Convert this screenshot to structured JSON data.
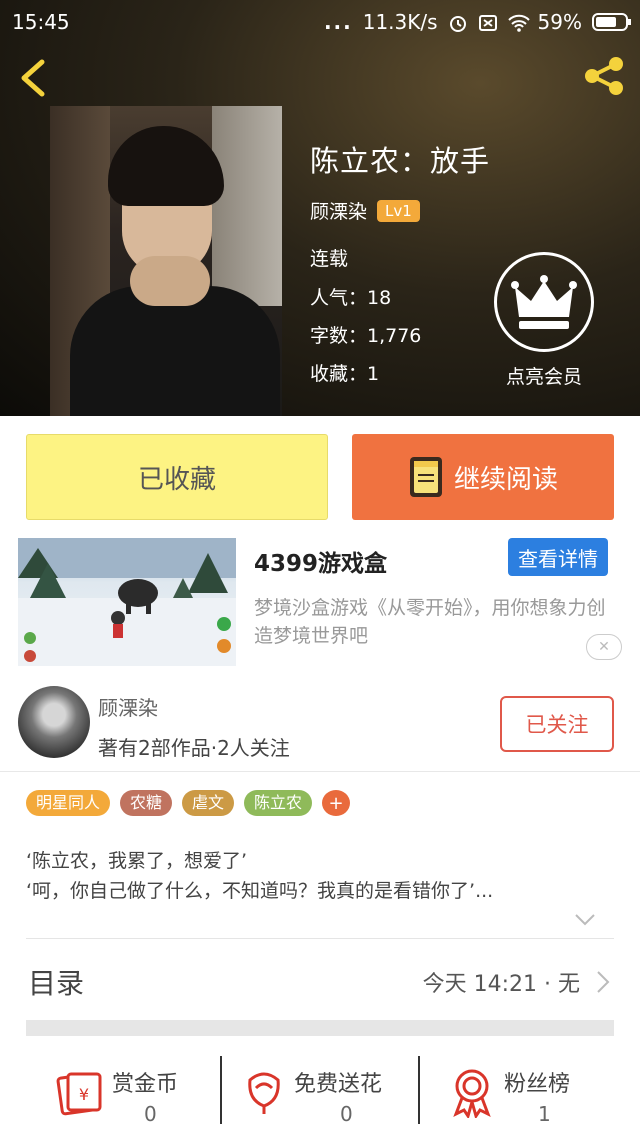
{
  "status_bar": {
    "time": "15:45",
    "dots": "...",
    "network_speed": "11.3K/s",
    "battery": "59%"
  },
  "book": {
    "title": "陈立农：放手",
    "author": "顾溧染",
    "level": "Lv1",
    "status": "连载",
    "popularity": "人气：18",
    "word_count": "字数：1,776",
    "favorites": "收藏：1",
    "vip_label": "点亮会员"
  },
  "actions": {
    "collected_label": "已收藏",
    "continue_label": "继续阅读"
  },
  "ad": {
    "name": "4399游戏盒",
    "detail_button": "查看详情",
    "description": "梦境沙盒游戏《从零开始》，用你想象力创造梦境世界吧",
    "close": "✕"
  },
  "author_card": {
    "name": "顾溧染",
    "stats": "著有2部作品·2人关注",
    "follow_label": "已关注"
  },
  "tags": [
    {
      "label": "明星同人",
      "color": "#f3a93a"
    },
    {
      "label": "农糖",
      "color": "#c0735f"
    },
    {
      "label": "虐文",
      "color": "#cc9a45"
    },
    {
      "label": "陈立农",
      "color": "#8fba5a"
    }
  ],
  "tag_add": "+",
  "synopsis": {
    "line1": "‘陈立农，我累了，想爱了’",
    "line2": "‘呵，你自己做了什么，不知道吗？我真的是看错你了’..."
  },
  "toc": {
    "title": "目录",
    "update": "今天 14:21 · 无"
  },
  "bottom_bar": [
    {
      "label": "赏金币",
      "count": "0",
      "icon": "reward-coin-icon"
    },
    {
      "label": "免费送花",
      "count": "0",
      "icon": "flower-icon"
    },
    {
      "label": "粉丝榜",
      "count": "1",
      "icon": "ribbon-medal-icon"
    }
  ],
  "colors": {
    "accent_orange": "#f07240",
    "collected_yellow": "#fdf383",
    "follow_red": "#e0584a",
    "ad_button_blue": "#2c7fe0",
    "lv_badge": "#f3a93a",
    "share_icon": "#f4d23c",
    "back_icon": "#f4d23c"
  }
}
